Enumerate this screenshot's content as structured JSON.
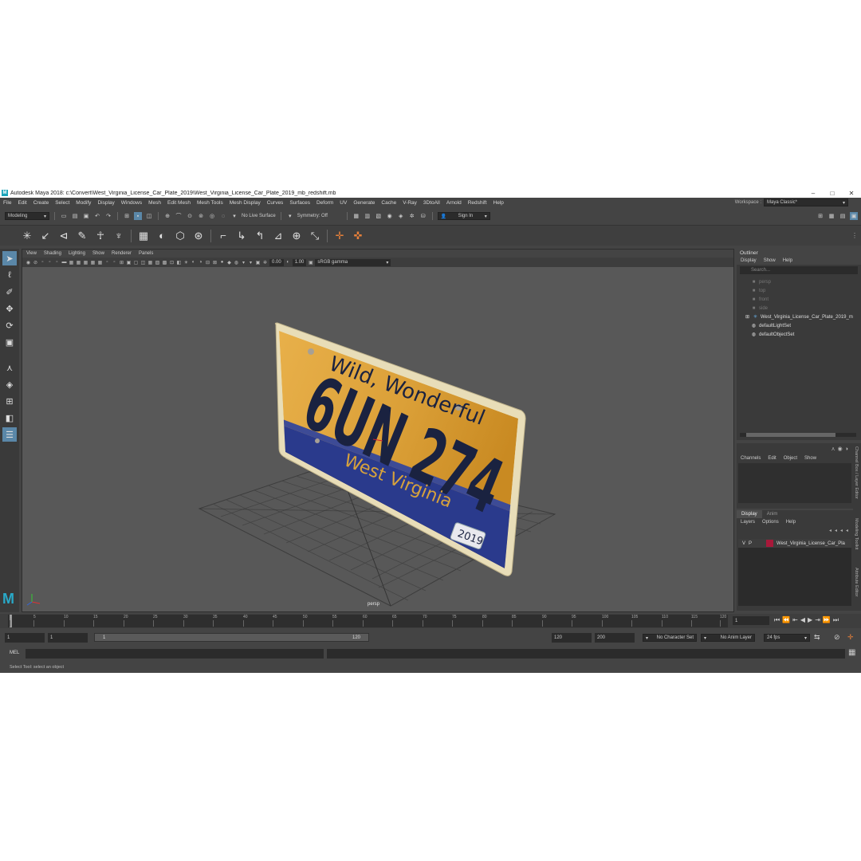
{
  "window": {
    "logo": "M",
    "title": "Autodesk Maya 2018: c:\\Convert\\West_Virginia_License_Car_Plate_2019\\West_Virginia_License_Car_Plate_2019_mb_redshift.mb",
    "minimize": "–",
    "maximize": "□",
    "close": "✕"
  },
  "menubar": {
    "items": [
      "File",
      "Edit",
      "Create",
      "Select",
      "Modify",
      "Display",
      "Windows",
      "Mesh",
      "Edit Mesh",
      "Mesh Tools",
      "Mesh Display",
      "Curves",
      "Surfaces",
      "Deform",
      "UV",
      "Generate",
      "Cache",
      "V-Ray",
      "3DtoAll",
      "Arnold",
      "Redshift",
      "Help"
    ],
    "workspace_label": "Workspace :",
    "workspace_value": "Maya Classic*"
  },
  "statusline": {
    "mode": "Modeling",
    "live_surface": "No Live Surface",
    "symmetry": "Symmetry: Off",
    "signin": "Sign In"
  },
  "viewport": {
    "menu": [
      "View",
      "Shading",
      "Lighting",
      "Show",
      "Renderer",
      "Panels"
    ],
    "exposure": "0.00",
    "gamma_value": "1.00",
    "color_space": "sRGB gamma",
    "camera": "persp"
  },
  "plate": {
    "tagline": "Wild, Wonderful",
    "number": "6UN 274",
    "state": "West Virginia",
    "year": "2019",
    "plate_color": "#e3a53a",
    "band_color": "#2a3a8c",
    "text_color": "#1a2240",
    "frame_color": "#e8ddb8"
  },
  "outliner": {
    "title": "Outliner",
    "menu": [
      "Display",
      "Show",
      "Help"
    ],
    "search_placeholder": "Search...",
    "items": [
      {
        "label": "persp",
        "dim": true,
        "icon": "camera-icon"
      },
      {
        "label": "top",
        "dim": true,
        "icon": "camera-icon"
      },
      {
        "label": "front",
        "dim": true,
        "icon": "camera-icon"
      },
      {
        "label": "side",
        "dim": true,
        "icon": "camera-icon"
      },
      {
        "label": "West_Virginia_License_Car_Plate_2019_m",
        "dim": false,
        "icon": "group-icon"
      },
      {
        "label": "defaultLightSet",
        "dim": false,
        "icon": "set-icon"
      },
      {
        "label": "defaultObjectSet",
        "dim": false,
        "icon": "set-icon"
      }
    ]
  },
  "channelbox": {
    "menu": [
      "Channels",
      "Edit",
      "Object",
      "Show"
    ]
  },
  "layers": {
    "tabs": [
      "Display",
      "Anim"
    ],
    "menu": [
      "Layers",
      "Options",
      "Help"
    ],
    "row": {
      "v": "V",
      "p": "P",
      "name": "West_Virginia_License_Car_Pla"
    }
  },
  "side_tabs": [
    "Channel Box / Layer Editor",
    "Modeling Toolkit",
    "Attribute Editor"
  ],
  "timeline": {
    "ticks": [
      "5",
      "10",
      "15",
      "20",
      "25",
      "30",
      "35",
      "40",
      "45",
      "50",
      "55",
      "60",
      "65",
      "70",
      "75",
      "80",
      "85",
      "90",
      "95",
      "100",
      "105",
      "110",
      "115",
      "120"
    ],
    "first_tick": "1",
    "current_frame": "1"
  },
  "range": {
    "start": "1",
    "playback_start": "1",
    "range_start": "1",
    "range_end": "120",
    "playback_end": "120",
    "end": "200",
    "character_set": "No Character Set",
    "anim_layer": "No Anim Layer",
    "fps": "24 fps"
  },
  "cmd": {
    "label": "MEL"
  },
  "help": {
    "text": "Select Tool: select an object"
  }
}
